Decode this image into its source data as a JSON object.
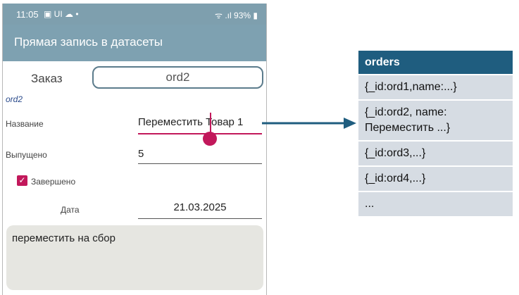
{
  "status_bar": {
    "time": "11:05",
    "left_icons": "▣ UI ☁ •",
    "signal_text": "ᯤ .ıl",
    "battery": "93%"
  },
  "app_bar": {
    "title": "Прямая запись в датасеты"
  },
  "form": {
    "order_label": "Заказ",
    "order_value": "ord2",
    "order_id_echo": "ord2",
    "name_label": "Название",
    "name_value": "Переместить Товар 1",
    "issued_label": "Выпущено",
    "issued_value": "5",
    "done_label": "Завершено",
    "done_checked": true,
    "date_label": "Дата",
    "date_value": "21.03.2025",
    "note_value": "переместить на сбор"
  },
  "orders_table": {
    "header": "orders",
    "rows": [
      "{_id:ord1,name:...}",
      "{_id:ord2, name:",
      "Переместить ...}",
      "{_id:ord3,...}",
      "{_id:ord4,...}",
      "..."
    ]
  },
  "colors": {
    "app_bar": "#7ea1b1",
    "accent": "#c2185b",
    "table_header": "#1f5d7f",
    "table_row": "#d6dce3"
  }
}
